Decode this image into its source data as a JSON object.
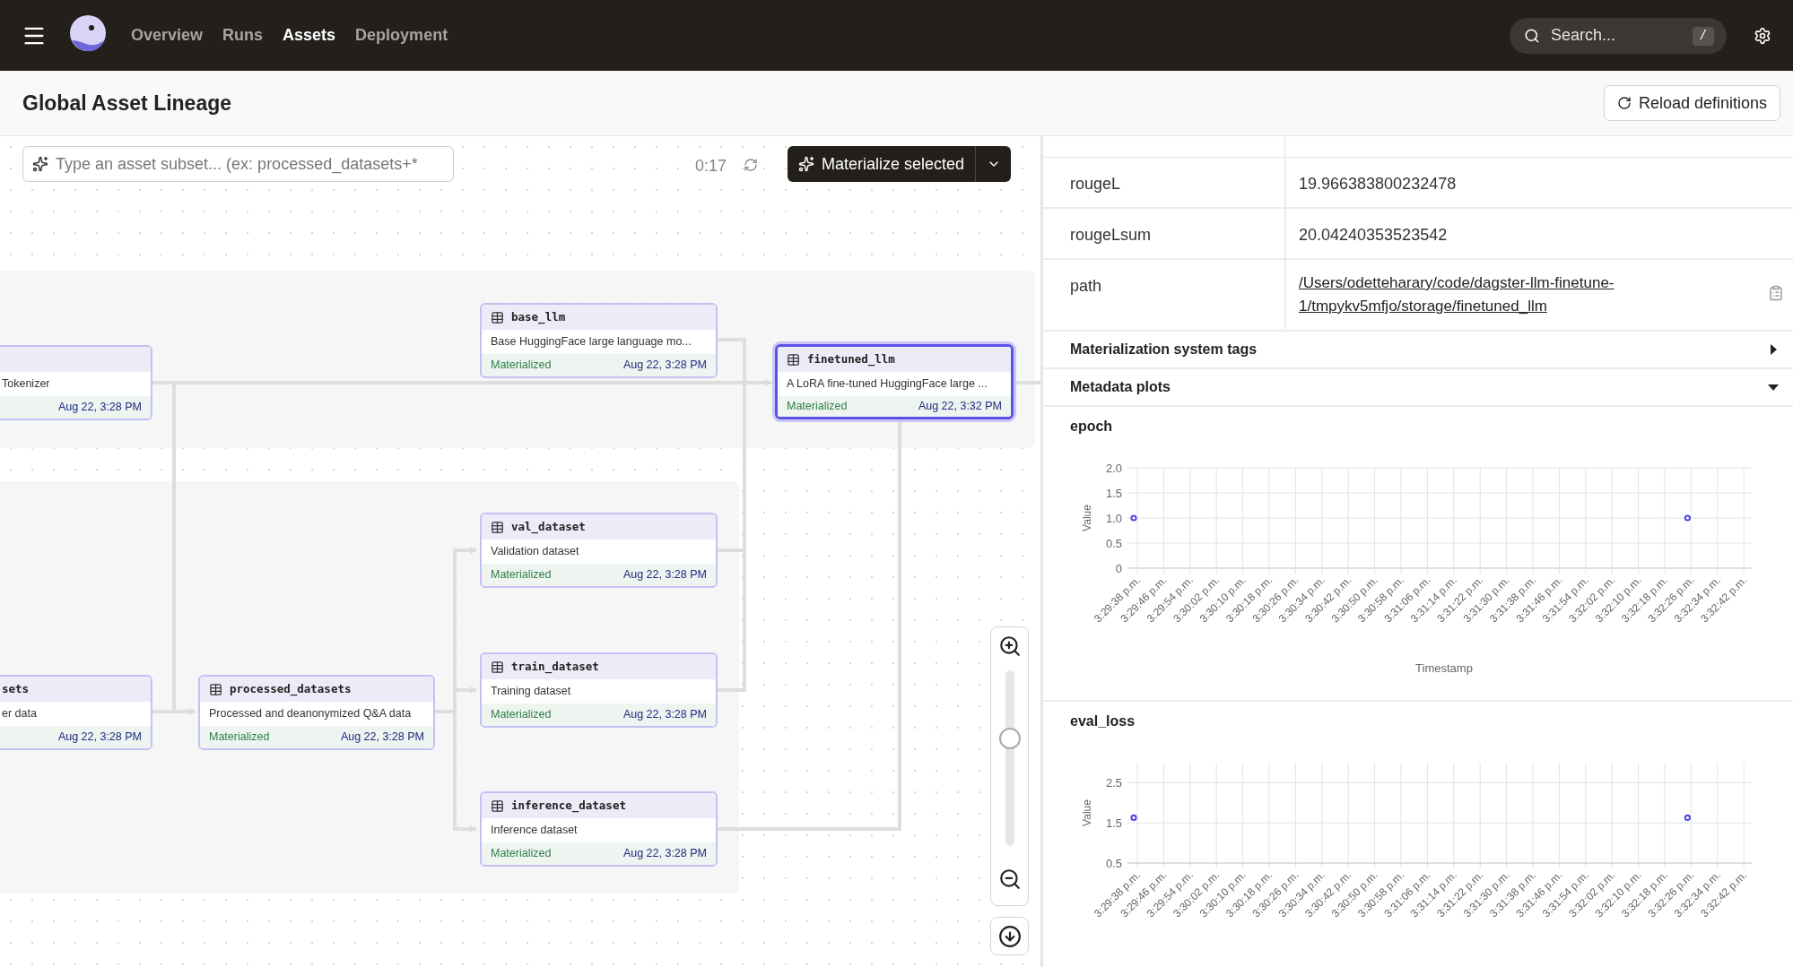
{
  "nav": {
    "items": [
      {
        "label": "Overview",
        "selected": false
      },
      {
        "label": "Runs",
        "selected": false
      },
      {
        "label": "Assets",
        "selected": true
      },
      {
        "label": "Deployment",
        "selected": false
      }
    ],
    "search": {
      "placeholder": "Search...",
      "shortcut": "/"
    }
  },
  "page": {
    "title": "Global Asset Lineage",
    "reload_button": "Reload definitions"
  },
  "graph": {
    "filter": {
      "placeholder": "Type an asset subset... (ex: processed_datasets+*"
    },
    "timer": "0:17",
    "materialize_button": "Materialize selected",
    "nodes": [
      {
        "description": "Tokenizer",
        "timestamp": "Aug 22, 3:28 PM",
        "selected": false
      },
      {
        "title": "base_llm",
        "description": "Base HuggingFace large language mo...",
        "status": "Materialized",
        "timestamp": "Aug 22, 3:28 PM",
        "selected": false
      },
      {
        "title": "finetuned_llm",
        "description": "A LoRA fine-tuned HuggingFace large ...",
        "status": "Materialized",
        "timestamp": "Aug 22, 3:32 PM",
        "selected": true
      },
      {
        "title": "val_dataset",
        "description": "Validation dataset",
        "status": "Materialized",
        "timestamp": "Aug 22, 3:28 PM",
        "selected": false
      },
      {
        "title": "train_dataset",
        "description": "Training dataset",
        "status": "Materialized",
        "timestamp": "Aug 22, 3:28 PM",
        "selected": false
      },
      {
        "title": "sets",
        "description": "er data",
        "timestamp": "Aug 22, 3:28 PM",
        "selected": false
      },
      {
        "title": "processed_datasets",
        "description": "Processed and deanonymized Q&A data",
        "status": "Materialized",
        "timestamp": "Aug 22, 3:28 PM",
        "selected": false
      },
      {
        "title": "inference_dataset",
        "description": "Inference dataset",
        "status": "Materialized",
        "timestamp": "Aug 22, 3:28 PM",
        "selected": false
      }
    ],
    "zoom": {
      "level": 0.63
    }
  },
  "details": {
    "rows": [
      {
        "key": "rougeL",
        "value": "19.966383800232478",
        "kind": "text"
      },
      {
        "key": "rougeLsum",
        "value": "20.04240353523542",
        "kind": "text"
      },
      {
        "key": "path",
        "value": "/Users/odetteharary/code/dagster-llm-finetune-1/tmpykv5mfjo/storage/finetuned_llm",
        "kind": "link"
      }
    ],
    "sections": [
      {
        "label": "Materialization system tags",
        "expanded": false
      },
      {
        "label": "Metadata plots",
        "expanded": true
      }
    ],
    "plots": [
      {
        "title": "epoch",
        "chart_data": {
          "type": "scatter",
          "xlabel": "Timestamp",
          "ylabel": "Value",
          "categories": [
            "3:29:38 p.m.",
            "3:29:46 p.m.",
            "3:29:54 p.m.",
            "3:30:02 p.m.",
            "3:30:10 p.m.",
            "3:30:18 p.m.",
            "3:30:26 p.m.",
            "3:30:34 p.m.",
            "3:30:42 p.m.",
            "3:30:50 p.m.",
            "3:30:58 p.m.",
            "3:31:06 p.m.",
            "3:31:14 p.m.",
            "3:31:22 p.m.",
            "3:31:30 p.m.",
            "3:31:38 p.m.",
            "3:31:46 p.m.",
            "3:31:54 p.m.",
            "3:32:02 p.m.",
            "3:32:10 p.m.",
            "3:32:18 p.m.",
            "3:32:26 p.m.",
            "3:32:34 p.m.",
            "3:32:42 p.m."
          ],
          "grid": true,
          "series": [
            {
              "color": "#4f46e5",
              "values": [
                1,
                null,
                null,
                null,
                null,
                null,
                null,
                null,
                null,
                null,
                null,
                null,
                null,
                null,
                null,
                null,
                null,
                null,
                null,
                null,
                null,
                1,
                null,
                null
              ]
            }
          ],
          "ylim": [
            0,
            2
          ],
          "yticks": [
            {
              "value": 0,
              "label": "0"
            },
            {
              "value": 0.5,
              "label": "0.5"
            },
            {
              "value": 1,
              "label": "1.0"
            },
            {
              "value": 1.5,
              "label": "1.5"
            },
            {
              "value": 2,
              "label": "2.0"
            }
          ]
        }
      },
      {
        "title": "eval_loss",
        "chart_data": {
          "type": "scatter",
          "ylabel": "Value",
          "categories": [
            "3:29:38 p.m.",
            "3:29:46 p.m.",
            "3:29:54 p.m.",
            "3:30:02 p.m.",
            "3:30:10 p.m.",
            "3:30:18 p.m.",
            "3:30:26 p.m.",
            "3:30:34 p.m.",
            "3:30:42 p.m.",
            "3:30:50 p.m.",
            "3:30:58 p.m.",
            "3:31:06 p.m.",
            "3:31:14 p.m.",
            "3:31:22 p.m.",
            "3:31:30 p.m.",
            "3:31:38 p.m.",
            "3:31:46 p.m.",
            "3:31:54 p.m.",
            "3:32:02 p.m.",
            "3:32:10 p.m.",
            "3:32:18 p.m.",
            "3:32:26 p.m.",
            "3:32:34 p.m.",
            "3:32:42 p.m."
          ],
          "grid": true,
          "series": [
            {
              "color": "#4f46e5",
              "values": [
                1.63,
                null,
                null,
                null,
                null,
                null,
                null,
                null,
                null,
                null,
                null,
                null,
                null,
                null,
                null,
                null,
                null,
                null,
                null,
                null,
                null,
                1.63,
                null,
                null
              ]
            }
          ],
          "ylim": [
            0.5,
            3
          ],
          "yticks": [
            {
              "value": 0.5,
              "label": "0.5"
            },
            {
              "value": 1.5,
              "label": "1.5"
            },
            {
              "value": 2.5,
              "label": "2.5"
            }
          ]
        }
      }
    ]
  }
}
